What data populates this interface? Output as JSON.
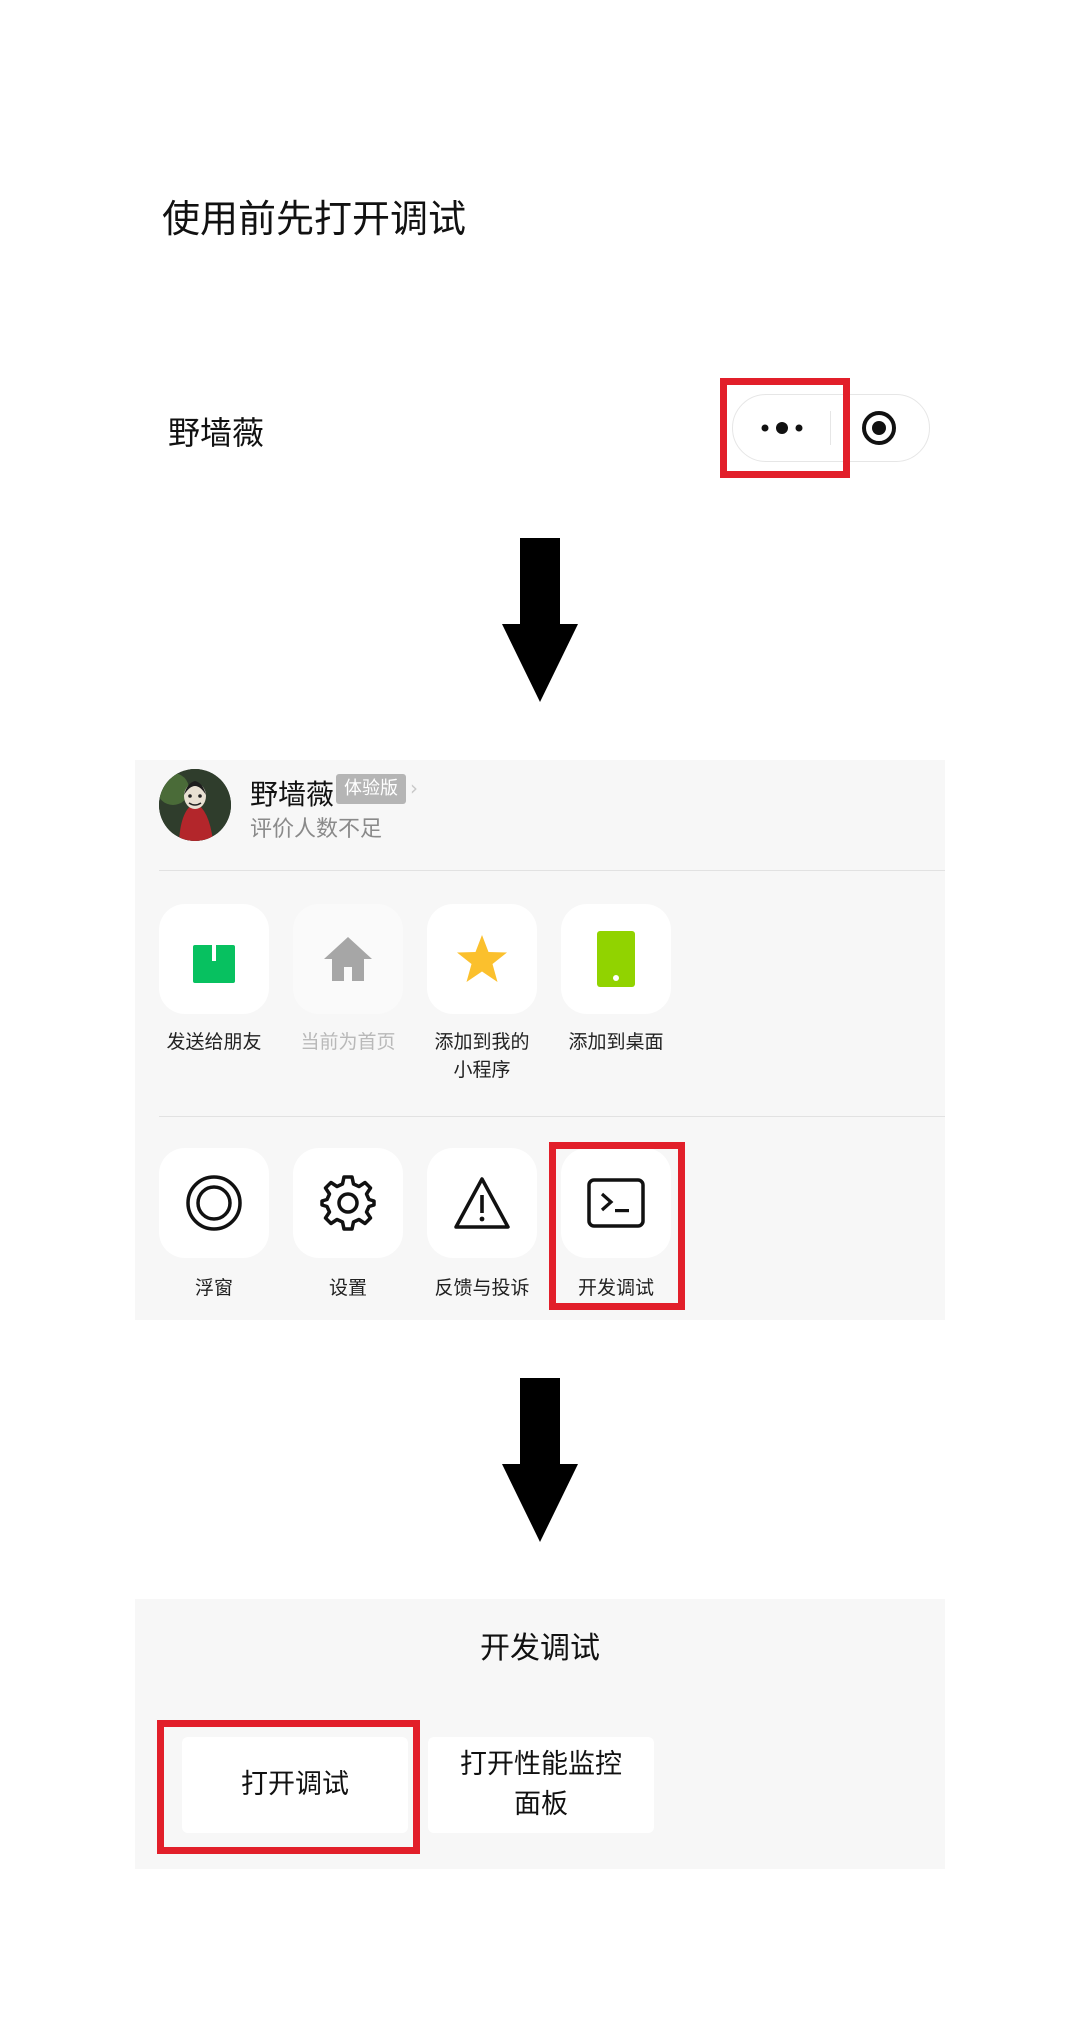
{
  "instruction_title": "使用前先打开调试",
  "app_name": "野墙薇",
  "menu": {
    "mp_name": "野墙薇",
    "badge": "体验版",
    "chevron": "›",
    "rating": "评价人数不足",
    "row1": [
      {
        "icon": "share-icon",
        "label": "发送给朋友",
        "disabled": false
      },
      {
        "icon": "home-icon",
        "label": "当前为首页",
        "disabled": true
      },
      {
        "icon": "star-icon",
        "label": "添加到我的\n小程序",
        "line1": "添加到我的",
        "line2": "小程序",
        "disabled": false
      },
      {
        "icon": "phone-icon",
        "label": "添加到桌面",
        "disabled": false
      }
    ],
    "row2": [
      {
        "icon": "float-window-icon",
        "label": "浮窗"
      },
      {
        "icon": "gear-icon",
        "label": "设置"
      },
      {
        "icon": "warning-icon",
        "label": "反馈与投诉"
      },
      {
        "icon": "terminal-icon",
        "label": "开发调试"
      }
    ]
  },
  "debug_sheet": {
    "title": "开发调试",
    "open_debug": "打开调试",
    "perf_line1": "打开性能监控",
    "perf_line2": "面板"
  },
  "colors": {
    "highlight": "#e21f2a",
    "share_green": "#07c160",
    "star_yellow": "#fbc02d",
    "phone_green": "#91d300",
    "home_gray": "#a6a6a6"
  }
}
